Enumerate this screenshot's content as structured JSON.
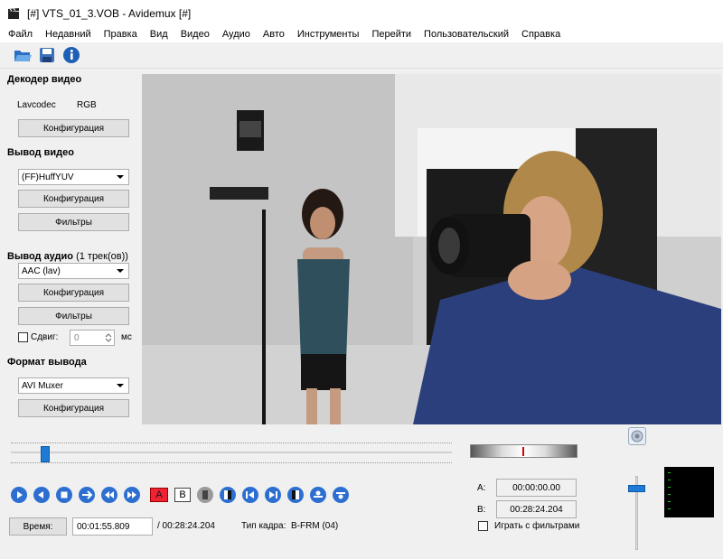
{
  "window": {
    "title": "[#] VTS_01_3.VOB - Avidemux [#]"
  },
  "menu": [
    "Файл",
    "Недавний",
    "Правка",
    "Вид",
    "Видео",
    "Аудио",
    "Авто",
    "Инструменты",
    "Перейти",
    "Пользовательский",
    "Справка"
  ],
  "toolbar": {
    "icons": [
      "open-icon",
      "save-icon",
      "info-icon"
    ]
  },
  "decoder": {
    "title": "Декодер видео",
    "codec": "Lavcodec",
    "colorspace": "RGB",
    "config_label": "Конфигурация"
  },
  "video_output": {
    "title": "Вывод видео",
    "codec": "(FF)HuffYUV",
    "config_label": "Конфигурация",
    "filters_label": "Фильтры"
  },
  "audio_output": {
    "title": "Вывод аудио",
    "tracks": "(1 трек(ов))",
    "codec": "AAC (lav)",
    "config_label": "Конфигурация",
    "filters_label": "Фильтры",
    "shift_label": "Сдвиг:",
    "shift_value": "0",
    "shift_unit": "мс"
  },
  "output_format": {
    "title": "Формат вывода",
    "muxer": "AVI Muxer",
    "config_label": "Конфигурация"
  },
  "timeline": {
    "position_fraction": 0.07
  },
  "controls": {
    "icons": [
      "play-icon",
      "rewind-icon",
      "stop-icon",
      "next-frame-icon",
      "prev-keyframe-icon",
      "next-keyframe-icon",
      "set-marker-a-icon",
      "set-marker-b-icon",
      "prev-black-icon",
      "goto-marker-a-icon",
      "goto-first-icon",
      "goto-last-icon",
      "goto-marker-b-icon",
      "prev-cut-icon",
      "next-cut-icon"
    ],
    "marker_a_label": "A",
    "marker_b_label": "B"
  },
  "time": {
    "button_label": "Время:",
    "current": "00:01:55.809",
    "total": "/ 00:28:24.204",
    "frame_type_label": "Тип кадра:",
    "frame_type": "B-FRM (04)"
  },
  "selection": {
    "a_label": "A:",
    "a_value": "00:00:00.00",
    "b_label": "B:",
    "b_value": "00:28:24.204",
    "play_filtered_label": "Играть с фильтрами"
  },
  "volume": {
    "level_fraction": 0.88
  }
}
